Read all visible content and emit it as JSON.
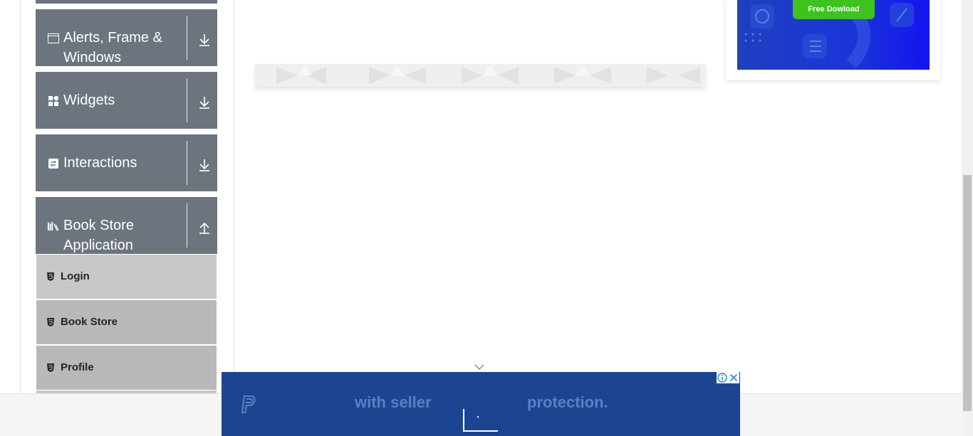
{
  "sidebar": {
    "groups": [
      {
        "label": "Alerts, Frame & Windows",
        "icon": "window-icon",
        "expanded": false
      },
      {
        "label": "Widgets",
        "icon": "widgets-grid-icon",
        "expanded": false
      },
      {
        "label": "Interactions",
        "icon": "interactions-swap-icon",
        "expanded": false
      },
      {
        "label": "Book Store Application",
        "icon": "books-shelf-icon",
        "expanded": true
      }
    ],
    "items": [
      {
        "label": "Login",
        "icon": "html5-badge-icon"
      },
      {
        "label": "Book Store",
        "icon": "html5-badge-icon"
      },
      {
        "label": "Profile",
        "icon": "html5-badge-icon"
      }
    ]
  },
  "ad_card": {
    "button_label": "Free Dowload"
  },
  "bottom_ad": {
    "text_left": "with seller",
    "text_right": "protection.",
    "brand_icon": "paypal-logo-icon",
    "info_icon": "ad-info-icon",
    "close_icon": "ad-close-icon"
  },
  "colors": {
    "sidebar_header": "#6c757d",
    "menu_item": "#c8c8c8",
    "menu_item_active": "#b9b9b9",
    "ad_button": "#3ec21e",
    "bottom_ad_bg": "#1c4591"
  }
}
